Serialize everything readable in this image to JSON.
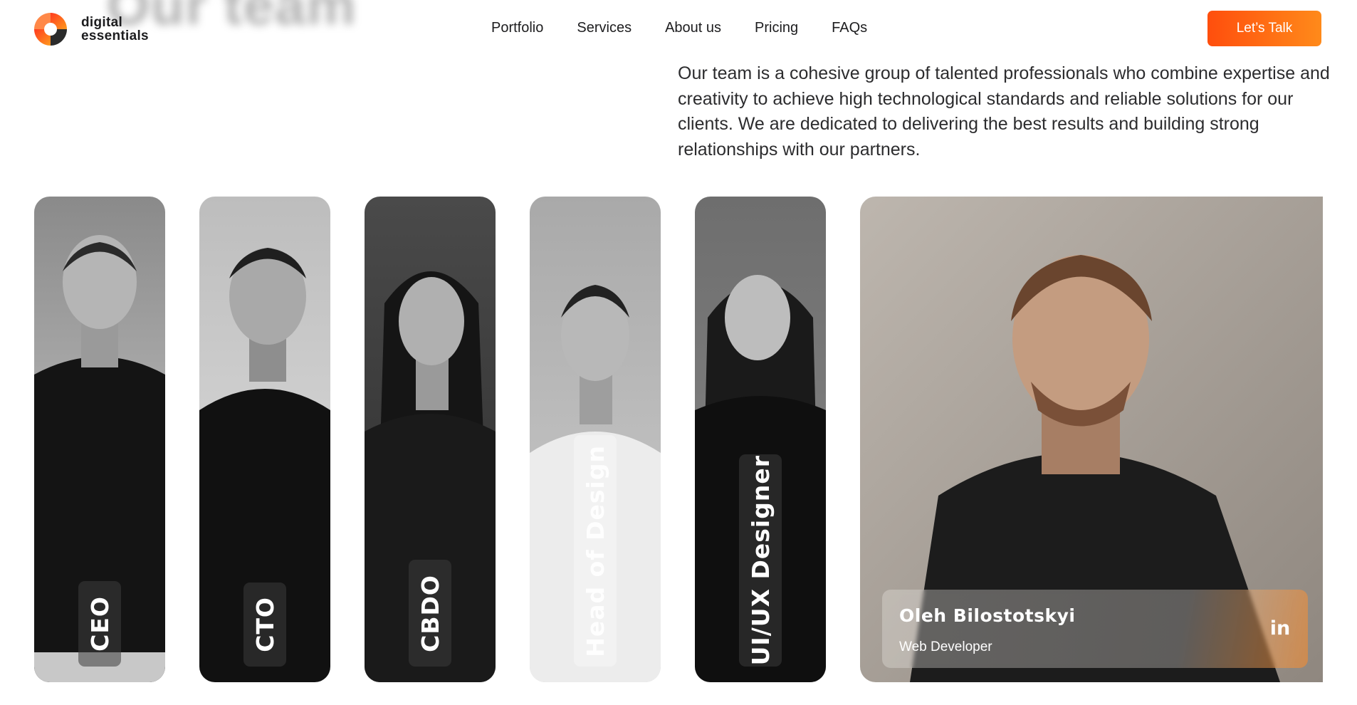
{
  "header": {
    "brand_line1": "digital",
    "brand_line2": "essentials",
    "nav": [
      {
        "label": "Portfolio"
      },
      {
        "label": "Services"
      },
      {
        "label": "About us"
      },
      {
        "label": "Pricing"
      },
      {
        "label": "FAQs"
      }
    ],
    "cta_label": "Let’s Talk",
    "blurred_heading": "Our team"
  },
  "intro_text": "Our team is a cohesive group of talented professionals who combine expertise and creativity to achieve high technological standards and reliable solutions for our clients. We are dedicated to delivering the best results and building strong relationships with our partners.",
  "team": [
    {
      "role": "CEO"
    },
    {
      "role": "CTO"
    },
    {
      "role": "CBDO"
    },
    {
      "role": "Head of Design"
    },
    {
      "role": "UI/UX Designer"
    }
  ],
  "featured": {
    "name": "Oleh Bilostotskyi",
    "role": "Web Developer",
    "social_icon": "linkedin-icon",
    "social_glyph": "in"
  },
  "colors": {
    "accent_start": "#ff4e0d",
    "accent_end": "#ff8a1a",
    "text": "#1d1d1f"
  }
}
